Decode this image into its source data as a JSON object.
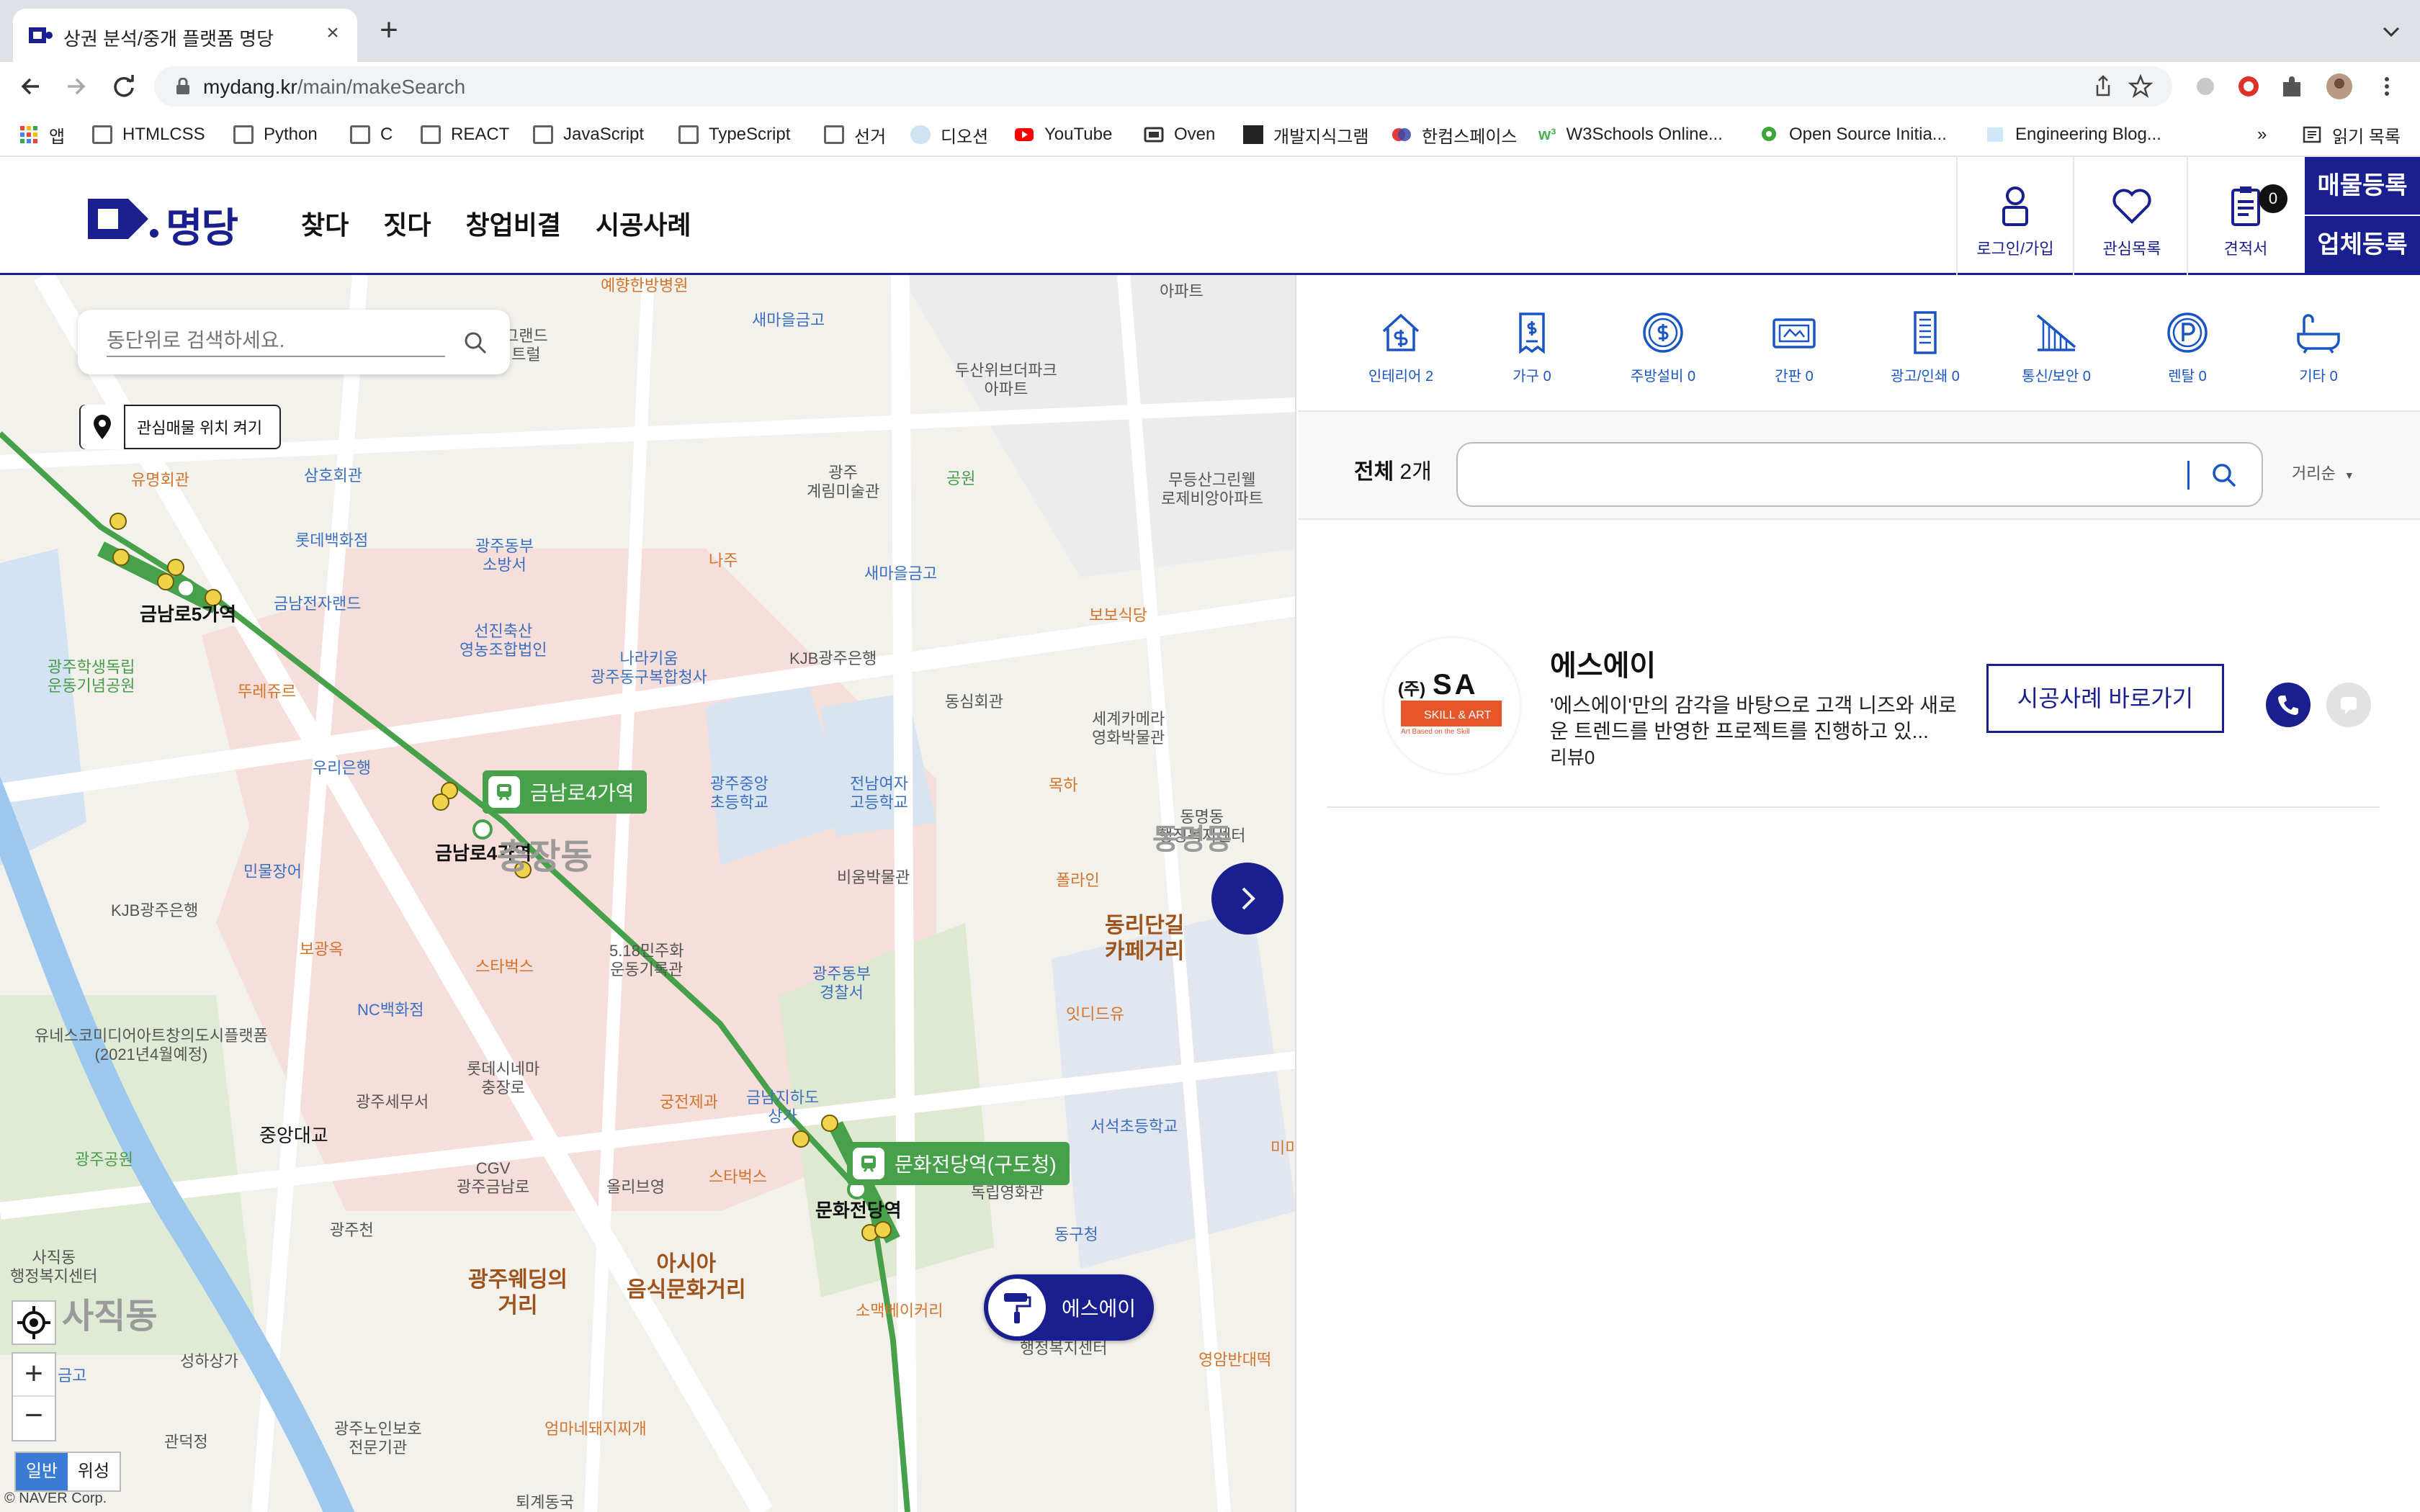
{
  "browser": {
    "tab_title": "상권 분석/중개 플랫폼 명당",
    "url_host": "mydang.kr",
    "url_path": "/main/makeSearch",
    "bookmarks": [
      "앱",
      "HTMLCSS",
      "Python",
      "C",
      "REACT",
      "JavaScript",
      "TypeScript",
      "선거",
      "디오션",
      "YouTube",
      "Oven",
      "개발지식그램",
      "한컴스페이스",
      "W3Schools Online...",
      "Open Source Initia...",
      "Engineering Blog..."
    ],
    "bookmarks_overflow": "»",
    "reading_list": "읽기 목록"
  },
  "header": {
    "logo_text": "명당",
    "nav": [
      "찾다",
      "짓다",
      "창업비결",
      "시공사례"
    ],
    "login_label": "로그인/가입",
    "favorites_label": "관심목록",
    "estimate_label": "견적서",
    "estimate_count": "0",
    "register_property": "매물등록",
    "register_company": "업체등록",
    "accent_color": "#1a1f8f"
  },
  "map": {
    "search_placeholder": "동단위로 검색하세요.",
    "fav_toggle_label": "관심매물 위치 켜기",
    "marker_label": "에스에이",
    "station_labels": [
      "금남로4가역",
      "문화전당역(구도청)"
    ],
    "pois": {
      "p1": "예향한방병원",
      "p2": "새마을금고",
      "p3": "그랜드\n트럴",
      "p4": "두산위브더파크\n아파트",
      "p5": "아파트",
      "p6": "유명회관",
      "p7": "삼호회관",
      "p8": "광주\n계림미술관",
      "p9": "공원",
      "p10": "무등산그린웰\n로제비앙아파트",
      "p11": "롯데백화점",
      "p12": "광주동부\n소방서",
      "p13": "금남전자랜드",
      "p14": "나주",
      "p15": "새마을금고",
      "p16": "보보식당",
      "p17": "금남로5가역",
      "p18": "선진축산\n영농조합법인",
      "p19": "나라키움\n광주동구복합청사",
      "p20": "KJB광주은행",
      "p21": "광주학생독립\n운동기념공원",
      "p22": "뚜레쥬르",
      "p23": "동심회관",
      "p24": "세계카메라\n영화박물관",
      "p25": "우리은행",
      "p26": "광주중앙\n초등학교",
      "p27": "전남여자\n고등학교",
      "p28": "목하",
      "p29": "동명동\n행정복지센터",
      "p30": "금남로4가역",
      "p31": "민물장어",
      "p32": "비움박물관",
      "p33": "폴라인",
      "p34": "KJB광주은행",
      "p35": "보광옥",
      "p36": "스타벅스",
      "p37": "5.18민주화\n운동기록관",
      "p38": "광주동부\n경찰서",
      "p39": "동리단길\n카페거리",
      "p40": "NC백화점",
      "p41": "잇디드유",
      "p42": "유네스코미디어아트창의도시플랫폼\n(2021년4월예정)",
      "p43": "롯데시네마\n충장로",
      "p44": "궁전제과",
      "p45": "금남지하도\n상가",
      "p46": "광주세무서",
      "p47": "서석초등학교",
      "p48": "중앙대교",
      "p49": "CGV\n광주금남로",
      "p50": "올리브영",
      "p51": "스타벅스",
      "p52": "독립영화관",
      "p53": "광주공원",
      "p54": "문화전당역",
      "p55": "동구청",
      "p56": "광주천",
      "p57": "사직동\n행정복지센터",
      "p58": "광주웨딩의\n거리",
      "p59": "아시아\n음식문화거리",
      "p60": "소맥베이커리",
      "p61": "성하상가",
      "p62": "금고",
      "p63": "행정복지센터",
      "p64": "영암반대떡",
      "p65": "광주노인보호\n전문기관",
      "p66": "엄마네돼지찌개",
      "p67": "관덕정",
      "p68": "퇴계동국",
      "p69": "충장동",
      "p70": "사직동",
      "p71": "동명동",
      "p72": "미미"
    },
    "map_type_normal": "일반",
    "map_type_satellite": "위성",
    "copyright": "© NAVER Corp."
  },
  "categories": [
    {
      "label": "인테리어 2",
      "icon": "house-dollar-icon"
    },
    {
      "label": "가구 0",
      "icon": "receipt-icon"
    },
    {
      "label": "주방설비 0",
      "icon": "coin-icon"
    },
    {
      "label": "간판 0",
      "icon": "signboard-icon"
    },
    {
      "label": "광고/인쇄 0",
      "icon": "building-icon"
    },
    {
      "label": "통신/보안 0",
      "icon": "stairs-icon"
    },
    {
      "label": "렌탈 0",
      "icon": "parking-icon"
    },
    {
      "label": "기타 0",
      "icon": "bathtub-icon"
    }
  ],
  "list": {
    "total_label": "전체",
    "total_count": "2개",
    "sort_label": "거리순",
    "items": [
      {
        "name": "에스에이",
        "logo_prefix": "(주)",
        "logo_text": "SA",
        "logo_sub": "SKILL & ART",
        "logo_tagline": "Art Based on the Skill",
        "desc": "'에스에이'만의 감각을 바탕으로 고객 니즈와 새로운 트렌드를 반영한 프로젝트를 진행하고 있...",
        "review": "리뷰0",
        "case_button": "시공사례 바로가기"
      }
    ]
  }
}
